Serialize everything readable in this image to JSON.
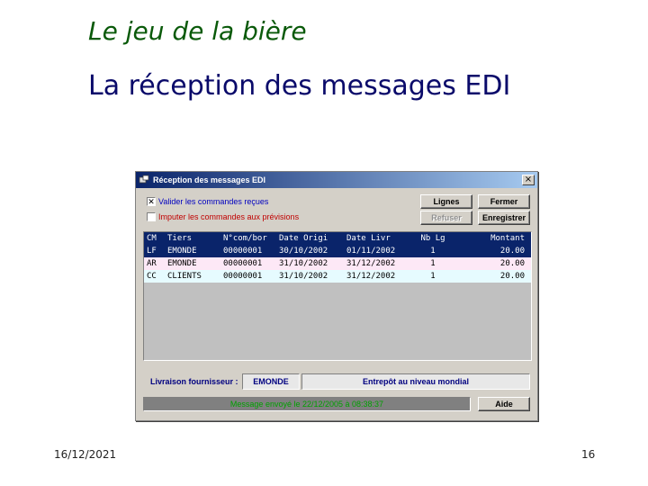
{
  "slide": {
    "title": "Le jeu de la bière",
    "subtitle": "La réception des messages EDI",
    "date": "16/12/2021",
    "page": "16"
  },
  "window": {
    "title": "Réception des messages EDI",
    "close_label": "×",
    "checkboxes": [
      {
        "label": "Valider les commandes reçues",
        "checked": true,
        "mark": "✕",
        "color": "#0000c0"
      },
      {
        "label": "Imputer les commandes aux prévisions",
        "checked": false,
        "mark": "",
        "color": "#c00000"
      }
    ],
    "buttons": {
      "lignes": "Lignes",
      "fermer": "Fermer",
      "refuser": "Refuser",
      "enregistrer": "Enregistrer",
      "aide": "Aide"
    },
    "table": {
      "headers": [
        "CM",
        "Tiers",
        "N°com/bor",
        "Date Origi",
        "Date Livr",
        "Nb Lg",
        "Montant"
      ],
      "rows": [
        {
          "cm": "LF",
          "tiers": "EMONDE",
          "ncom": "00000001",
          "date_origi": "30/10/2002",
          "date_livr": "01/11/2002",
          "nb_lg": "1",
          "montant": "20.00"
        },
        {
          "cm": "AR",
          "tiers": "EMONDE",
          "ncom": "00000001",
          "date_origi": "31/10/2002",
          "date_livr": "31/12/2002",
          "nb_lg": "1",
          "montant": "20.00"
        },
        {
          "cm": "CC",
          "tiers": "CLIENTS",
          "ncom": "00000001",
          "date_origi": "31/10/2002",
          "date_livr": "31/12/2002",
          "nb_lg": "1",
          "montant": "20.00"
        }
      ]
    },
    "fournisseur": {
      "label": "Livraison fournisseur :",
      "value": "EMONDE",
      "description": "Entrepôt au niveau mondial"
    },
    "status": "Message envoyé le 22/12/2005 à 08:38:37"
  },
  "colors": {
    "title_green": "#0a5a0a",
    "subtitle_navy": "#0a0a6a",
    "selection": "#0a246a",
    "status_text": "#00a000"
  }
}
